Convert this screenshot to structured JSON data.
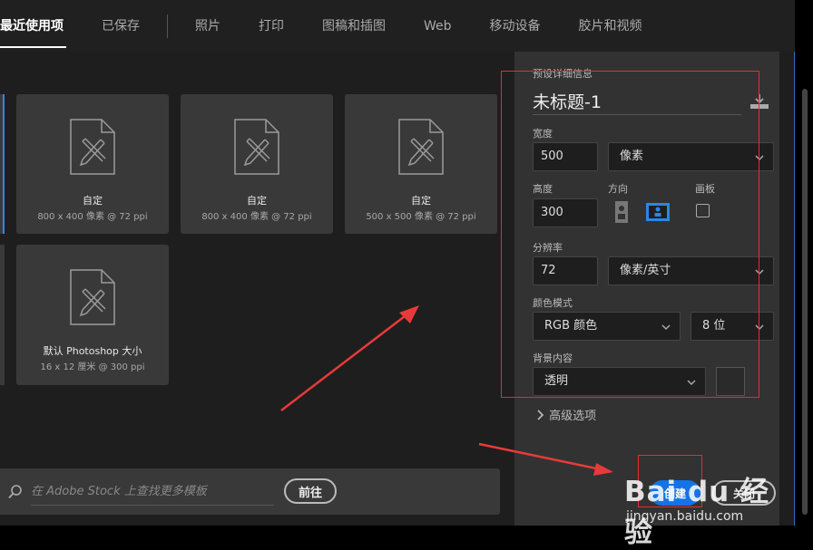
{
  "tabs": [
    "最近使用项",
    "已保存",
    "照片",
    "打印",
    "图稿和插图",
    "Web",
    "移动设备",
    "胶片和视频"
  ],
  "presets": [
    {
      "name": "自定",
      "meta": "800 x 400 像素 @ 72 ppi"
    },
    {
      "name": "自定",
      "meta": "800 x 400 像素 @ 72 ppi"
    },
    {
      "name": "自定",
      "meta": "500 x 500 像素 @ 72 ppi"
    },
    {
      "name": "默认 Photoshop 大小",
      "meta": "16 x 12 厘米 @ 300 ppi"
    }
  ],
  "search": {
    "placeholder": "在 Adobe Stock 上查找更多模板",
    "go_label": "前往"
  },
  "details": {
    "section_label": "预设详细信息",
    "doc_title": "未标题-1",
    "width_label": "宽度",
    "width_value": "500",
    "width_unit": "像素",
    "height_label": "高度",
    "height_value": "300",
    "orientation_label": "方向",
    "artboard_label": "画板",
    "resolution_label": "分辨率",
    "resolution_value": "72",
    "resolution_unit": "像素/英寸",
    "color_mode_label": "颜色模式",
    "color_mode_value": "RGB 颜色",
    "bit_depth_value": "8 位",
    "background_label": "背景内容",
    "background_value": "透明",
    "advanced_label": "高级选项"
  },
  "actions": {
    "create_label": "创建",
    "close_label": "关闭"
  },
  "watermark": {
    "logo": "Bai du 经验",
    "url": "jingyan.baidu.com"
  },
  "colors": {
    "accent": "#1473e6",
    "highlight": "#e03030"
  }
}
